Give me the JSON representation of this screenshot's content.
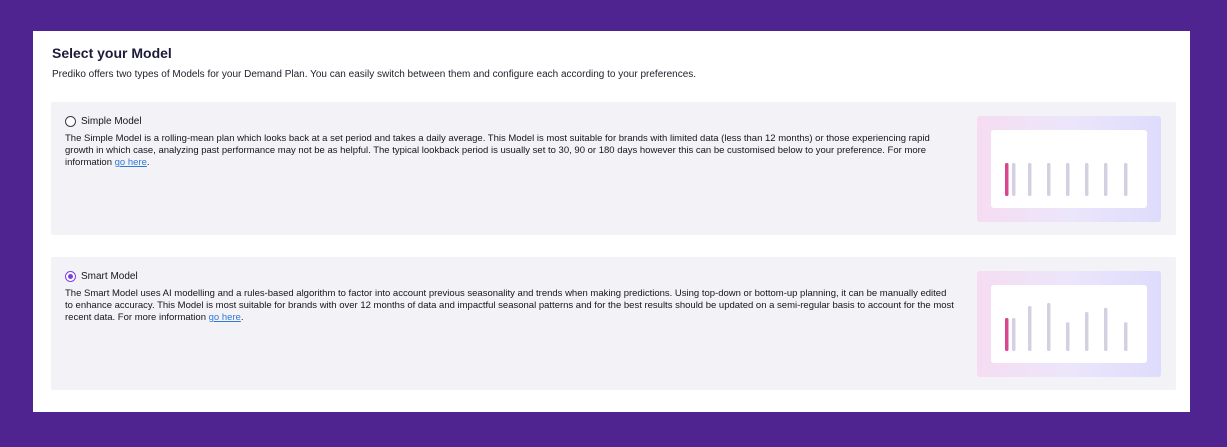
{
  "header": {
    "title": "Select your Model",
    "subtitle": "Prediko offers two types of Models for your Demand Plan. You can easily switch between them and configure each according to your preferences."
  },
  "models": [
    {
      "label": "Simple Model",
      "selected": false,
      "description": "The Simple Model is a rolling-mean plan which looks back at a set period and takes a daily average. This Model is most suitable for brands with limited data (less than 12 months) or those experiencing rapid growth in which case, analyzing past performance may not be as helpful. The typical lookback period is usually set to 30, 90 or 180 days however this can be customised below to your preference. For more information ",
      "link_text": "go here",
      "trailing": ".",
      "preview_bars": [
        0.55,
        0.55,
        0.55,
        0.55,
        0.55,
        0.55,
        0.55,
        0.55
      ]
    },
    {
      "label": "Smart Model",
      "selected": true,
      "description": "The Smart Model uses AI modelling and a rules-based algorithm to factor into account previous seasonality and trends when making predictions. Using top-down or bottom-up planning, it can be manually edited to enhance accuracy. This Model is most suitable for brands with over 12 months of data and impactful seasonal patterns and for the best results should be updated on a semi-regular basis to account for the most recent data. For more information ",
      "link_text": "go here",
      "trailing": ".",
      "preview_bars": [
        0.55,
        0.55,
        0.75,
        0.8,
        0.48,
        0.65,
        0.72,
        0.48
      ]
    }
  ],
  "colors": {
    "background": "#4f2390",
    "accent": "#7b3fe4",
    "highlight_bar": "#d9468e",
    "bar": "#d4d0e2",
    "link": "#2f7ad8"
  }
}
